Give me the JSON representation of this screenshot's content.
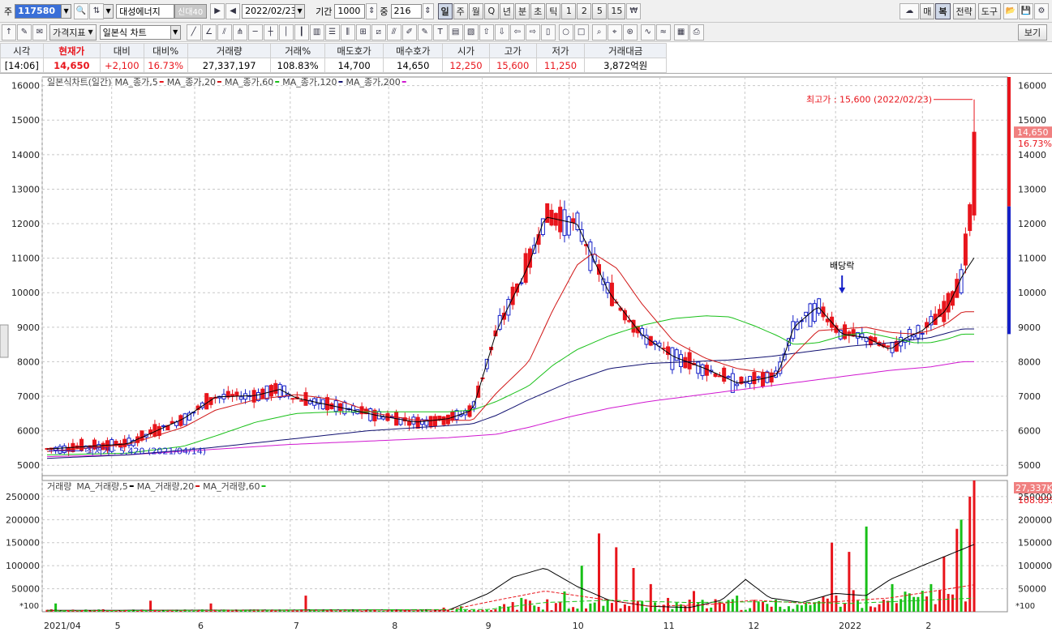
{
  "toolbar": {
    "label_ju": "주",
    "code": "117580",
    "name": "대성에너지",
    "badge": "신대40",
    "date": "2022/02/23",
    "period_label": "기간",
    "period_value": "1000",
    "count_label": "중",
    "count_value": "216",
    "timeframes": [
      "일",
      "주",
      "월",
      "Q",
      "년",
      "분",
      "초",
      "틱",
      "1",
      "2",
      "5",
      "15"
    ],
    "right_buttons": [
      "매",
      "복",
      "전략",
      "도구"
    ],
    "row2_left": [
      "가격지표",
      "일본식 차트"
    ],
    "view_button": "보기"
  },
  "quote": {
    "headers": [
      "시각",
      "현재가",
      "대비",
      "대비%",
      "거래량",
      "거래%",
      "매도호가",
      "매수호가",
      "시가",
      "고가",
      "저가",
      "거래대금"
    ],
    "values": [
      "[14:06]",
      "14,650",
      "+2,100",
      "16.73%",
      "27,337,197",
      "108.83%",
      "14,700",
      "14,650",
      "12,250",
      "15,600",
      "11,250",
      "3,872억원"
    ]
  },
  "colors": {
    "up": "#e8151c",
    "down": "#1520c8",
    "ma5": "#000000",
    "ma20": "#d01515",
    "ma60": "#18c018",
    "ma120": "#101070",
    "ma200": "#d018d0"
  },
  "chart_data": {
    "type": "candlestick",
    "title": "일본식차트(일간)",
    "legend": [
      "MA_종가,5",
      "MA_종가,20",
      "MA_종가,60",
      "MA_종가,120",
      "MA_종가,200"
    ],
    "y_ticks": [
      5000,
      6000,
      7000,
      8000,
      9000,
      10000,
      11000,
      12000,
      13000,
      14000,
      15000,
      16000
    ],
    "ylim": [
      4700,
      16250
    ],
    "x_tick_labels": [
      "2021/04",
      "5",
      "6",
      "7",
      "8",
      "9",
      "10",
      "11",
      "12",
      "2022",
      "2"
    ],
    "high_annotation": "최고가 : 15,600 (2022/02/23)",
    "low_annotation": "최저가 : 5,420 (2021/04/14)",
    "dividend_label": "배당락",
    "price_badge": "14,650",
    "price_pct": "16.73%",
    "ma_keyframes": {
      "ma5": [
        [
          0,
          5470
        ],
        [
          0.1,
          5620
        ],
        [
          0.17,
          6350
        ],
        [
          0.21,
          6980
        ],
        [
          0.26,
          7020
        ],
        [
          0.29,
          7200
        ],
        [
          0.31,
          6950
        ],
        [
          0.36,
          6700
        ],
        [
          0.41,
          6450
        ],
        [
          0.46,
          6250
        ],
        [
          0.5,
          6350
        ],
        [
          0.53,
          6600
        ],
        [
          0.56,
          8900
        ],
        [
          0.6,
          10800
        ],
        [
          0.62,
          12200
        ],
        [
          0.66,
          12000
        ],
        [
          0.7,
          10000
        ],
        [
          0.74,
          8800
        ],
        [
          0.78,
          8150
        ],
        [
          0.82,
          7800
        ],
        [
          0.86,
          7380
        ],
        [
          0.89,
          7500
        ],
        [
          0.91,
          7620
        ],
        [
          0.93,
          9000
        ],
        [
          0.96,
          9600
        ],
        [
          0.99,
          8800
        ],
        [
          1.02,
          8700
        ],
        [
          1.05,
          8350
        ],
        [
          1.07,
          8700
        ],
        [
          1.09,
          8900
        ],
        [
          1.12,
          9500
        ],
        [
          1.14,
          10500
        ],
        [
          1.16,
          11200
        ]
      ],
      "ma20": [
        [
          0,
          5400
        ],
        [
          0.1,
          5600
        ],
        [
          0.17,
          6100
        ],
        [
          0.21,
          6600
        ],
        [
          0.26,
          6900
        ],
        [
          0.31,
          7050
        ],
        [
          0.36,
          6900
        ],
        [
          0.41,
          6500
        ],
        [
          0.46,
          6300
        ],
        [
          0.5,
          6300
        ],
        [
          0.53,
          6300
        ],
        [
          0.56,
          7100
        ],
        [
          0.6,
          8000
        ],
        [
          0.63,
          9500
        ],
        [
          0.66,
          10800
        ],
        [
          0.68,
          11150
        ],
        [
          0.71,
          10700
        ],
        [
          0.74,
          9700
        ],
        [
          0.78,
          8600
        ],
        [
          0.82,
          8100
        ],
        [
          0.86,
          7800
        ],
        [
          0.89,
          7700
        ],
        [
          0.91,
          7650
        ],
        [
          0.93,
          8200
        ],
        [
          0.96,
          8900
        ],
        [
          0.99,
          8950
        ],
        [
          1.02,
          9000
        ],
        [
          1.05,
          8850
        ],
        [
          1.08,
          8800
        ],
        [
          1.1,
          8900
        ],
        [
          1.12,
          9100
        ],
        [
          1.14,
          9450
        ]
      ],
      "ma60": [
        [
          0,
          5300
        ],
        [
          0.1,
          5350
        ],
        [
          0.17,
          5550
        ],
        [
          0.21,
          5850
        ],
        [
          0.26,
          6250
        ],
        [
          0.31,
          6500
        ],
        [
          0.36,
          6550
        ],
        [
          0.41,
          6550
        ],
        [
          0.46,
          6550
        ],
        [
          0.5,
          6550
        ],
        [
          0.53,
          6600
        ],
        [
          0.56,
          6850
        ],
        [
          0.6,
          7300
        ],
        [
          0.63,
          7900
        ],
        [
          0.66,
          8350
        ],
        [
          0.7,
          8750
        ],
        [
          0.74,
          9050
        ],
        [
          0.78,
          9250
        ],
        [
          0.82,
          9330
        ],
        [
          0.85,
          9300
        ],
        [
          0.88,
          9050
        ],
        [
          0.91,
          8750
        ],
        [
          0.93,
          8500
        ],
        [
          0.96,
          8550
        ],
        [
          0.99,
          8750
        ],
        [
          1.02,
          8850
        ],
        [
          1.05,
          8700
        ],
        [
          1.08,
          8550
        ],
        [
          1.1,
          8550
        ],
        [
          1.12,
          8650
        ],
        [
          1.14,
          8800
        ]
      ],
      "ma120": [
        [
          0,
          5200
        ],
        [
          0.1,
          5300
        ],
        [
          0.2,
          5500
        ],
        [
          0.3,
          5750
        ],
        [
          0.4,
          6000
        ],
        [
          0.5,
          6150
        ],
        [
          0.53,
          6200
        ],
        [
          0.56,
          6450
        ],
        [
          0.6,
          6900
        ],
        [
          0.65,
          7400
        ],
        [
          0.7,
          7800
        ],
        [
          0.75,
          7950
        ],
        [
          0.8,
          8000
        ],
        [
          0.85,
          8050
        ],
        [
          0.9,
          8150
        ],
        [
          0.95,
          8300
        ],
        [
          1.0,
          8450
        ],
        [
          1.05,
          8550
        ],
        [
          1.1,
          8700
        ],
        [
          1.14,
          8950
        ]
      ],
      "ma200": [
        [
          0,
          5250
        ],
        [
          0.1,
          5300
        ],
        [
          0.2,
          5450
        ],
        [
          0.3,
          5600
        ],
        [
          0.4,
          5700
        ],
        [
          0.5,
          5800
        ],
        [
          0.56,
          5900
        ],
        [
          0.6,
          6100
        ],
        [
          0.65,
          6400
        ],
        [
          0.7,
          6650
        ],
        [
          0.75,
          6850
        ],
        [
          0.8,
          7000
        ],
        [
          0.85,
          7150
        ],
        [
          0.9,
          7300
        ],
        [
          0.95,
          7450
        ],
        [
          1.0,
          7600
        ],
        [
          1.05,
          7750
        ],
        [
          1.1,
          7850
        ],
        [
          1.14,
          8000
        ]
      ]
    },
    "volume": {
      "title": "거래량",
      "legend": [
        "MA_거래량,5",
        "MA_거래량,20",
        "MA_거래량,60"
      ],
      "y_ticks": [
        50000,
        100000,
        150000,
        200000,
        250000
      ],
      "ylim": [
        0,
        285000
      ],
      "unit": "*100",
      "value_badge": "27,337K",
      "pct_badge": "108.83%"
    }
  }
}
